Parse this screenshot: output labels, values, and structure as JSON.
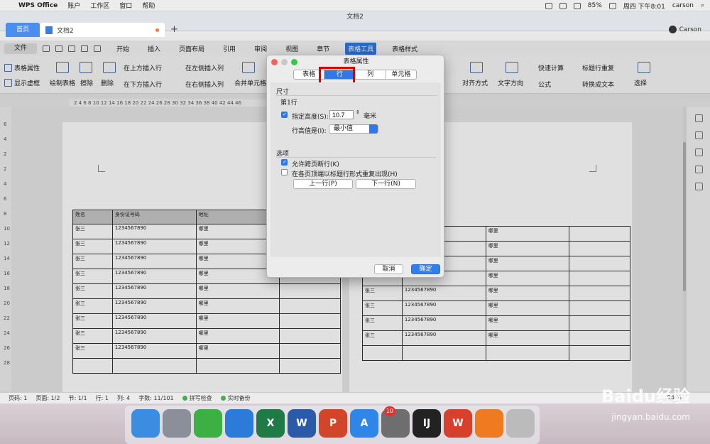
{
  "menubar": {
    "apple": "",
    "app": "WPS Office",
    "items": [
      "账户",
      "工作区",
      "窗口",
      "帮助"
    ],
    "battery": "85%",
    "time": "周四 下午8:01",
    "user": "carson"
  },
  "window": {
    "title": "文档2"
  },
  "tabs": {
    "home": "首页",
    "doc": "文档2",
    "user": "Carson"
  },
  "ribbon": {
    "file": "文件",
    "tabs": [
      "开始",
      "插入",
      "页面布局",
      "引用",
      "审阅",
      "视图",
      "章节",
      "表格工具",
      "表格样式"
    ],
    "active": "表格工具"
  },
  "toolbar": {
    "table_props": "表格属性",
    "show_grid": "显示虚框",
    "draw_table": "绘制表格",
    "erase": "擦除",
    "delete": "删除",
    "insert_above": "在上方插入行",
    "insert_left": "在左侧插入列",
    "insert_below": "在下方插入行",
    "insert_right": "在右侧插入列",
    "merge": "合并单元格",
    "align": "对齐方式",
    "text_dir": "文字方向",
    "quick_calc": "快速计算",
    "repeat_header": "标题行重复",
    "formula": "公式",
    "to_text": "转换成文本",
    "select": "选择"
  },
  "ruler": {
    "ticks": "2  4  6  8  10 12 14 16 18 20 22 24 26 28 30 32 34 36 38 40 42 44 46"
  },
  "vruler": [
    "6",
    "4",
    "2",
    "2",
    "4",
    "6",
    "8",
    "10",
    "12",
    "14",
    "16",
    "18",
    "20",
    "22",
    "24",
    "26",
    "28"
  ],
  "table": {
    "headers": [
      "姓名",
      "身份证号码",
      "地址",
      ""
    ],
    "name": "张三",
    "id": "1234567890",
    "addr": "哪里"
  },
  "dialog": {
    "title": "表格属性",
    "tabs": [
      "表格",
      "行",
      "列",
      "单元格"
    ],
    "active_tab": "行",
    "size_section": "尺寸",
    "row_label": "第1行",
    "height_label": "指定高度(S):",
    "height_value": "10.7",
    "unit": "毫米",
    "row_height_is": "行高值是(I):",
    "row_height_mode": "最小值",
    "options_section": "选项",
    "allow_break": "允许跨页断行(K)",
    "repeat_header": "在各页顶端以标题行形式重复出现(H)",
    "prev_row": "上一行(P)",
    "next_row": "下一行(N)",
    "cancel": "取消",
    "ok": "确定",
    "allow_break_checked": true,
    "height_checked": true,
    "repeat_checked": false
  },
  "status": {
    "page": "页码: 1",
    "pages": "页面: 1/2",
    "section": "节: 1/1",
    "row": "行: 1",
    "col": "列: 4",
    "words": "字数: 11/101",
    "spell": "拼写检查",
    "backup": "实时备份",
    "zoom": "96 %"
  },
  "dock": {
    "badge": "10",
    "apps": [
      "finder-icon",
      "launchpad-icon",
      "wechat-icon",
      "safari-icon",
      "excel-icon",
      "word-icon",
      "powerpoint-icon",
      "appstore-icon",
      "settings-icon",
      "intellij-icon",
      "wps-icon",
      "firefox-icon",
      "trash-icon"
    ]
  },
  "watermark": {
    "line1": "Baidu经验",
    "line2": "jingyan.baidu.com"
  }
}
